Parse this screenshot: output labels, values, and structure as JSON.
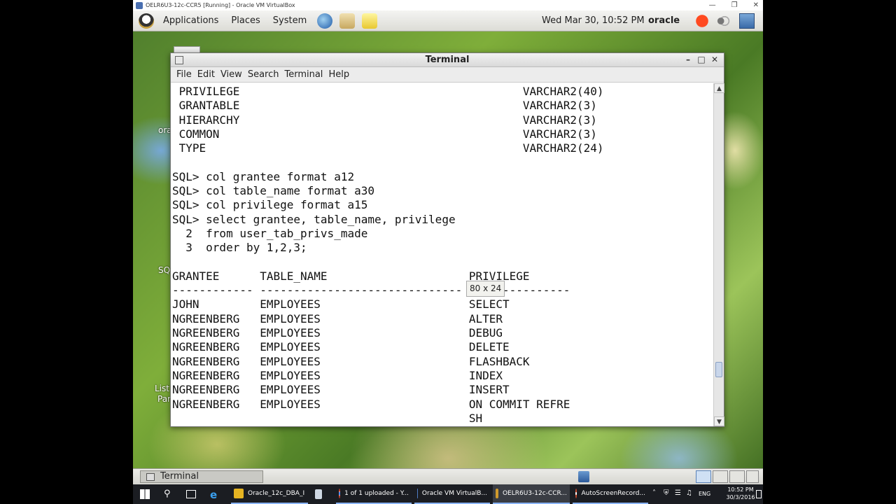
{
  "host_window": {
    "title": "OELR6U3-12c-CCR5 [Running] - Oracle VM VirtualBox"
  },
  "gnome_panel": {
    "menus": [
      "Applications",
      "Places",
      "System"
    ],
    "clock": "Wed Mar 30, 10:52 PM",
    "user": "oracle"
  },
  "desktop_labels": [
    "ora",
    "SQ",
    "List",
    "Par"
  ],
  "terminal": {
    "title": "Terminal",
    "menus": [
      "File",
      "Edit",
      "View",
      "Search",
      "Terminal",
      "Help"
    ],
    "lines": [
      " PRIVILEGE                                          VARCHAR2(40)",
      " GRANTABLE                                          VARCHAR2(3)",
      " HIERARCHY                                          VARCHAR2(3)",
      " COMMON                                             VARCHAR2(3)",
      " TYPE                                               VARCHAR2(24)",
      "",
      "SQL> col grantee format a12",
      "SQL> col table_name format a30",
      "SQL> col privilege format a15",
      "SQL> select grantee, table_name, privilege",
      "  2  from user_tab_privs_made",
      "  3  order by 1,2,3;",
      "",
      "GRANTEE      TABLE_NAME                     PRIVILEGE",
      "------------ ------------------------------ ---------------",
      "JOHN         EMPLOYEES                      SELECT",
      "NGREENBERG   EMPLOYEES                      ALTER",
      "NGREENBERG   EMPLOYEES                      DEBUG",
      "NGREENBERG   EMPLOYEES                      DELETE",
      "NGREENBERG   EMPLOYEES                      FLASHBACK",
      "NGREENBERG   EMPLOYEES                      INDEX",
      "NGREENBERG   EMPLOYEES                      INSERT",
      "NGREENBERG   EMPLOYEES                      ON COMMIT REFRE",
      "                                            SH"
    ],
    "size_tooltip": "80 x 24"
  },
  "gnome_bottom": {
    "task_label": "Terminal"
  },
  "windows_taskbar": {
    "apps": [
      {
        "label": "Oracle_12c_DBA_I",
        "color": "#e6b422"
      },
      {
        "label": "",
        "color": "#cfd8e3"
      },
      {
        "label": "1 of 1 uploaded - Y...",
        "color": "#e0442c"
      },
      {
        "label": "Oracle VM VirtualB...",
        "color": "#4f7cc4"
      },
      {
        "label": "OELR6U3-12c-CCR...",
        "color": "#d09a2c"
      },
      {
        "label": "AutoScreenRecord...",
        "color": "#d04a2a"
      }
    ],
    "language": "ENG",
    "time": "10:52 PM",
    "date": "30/3/2016"
  }
}
